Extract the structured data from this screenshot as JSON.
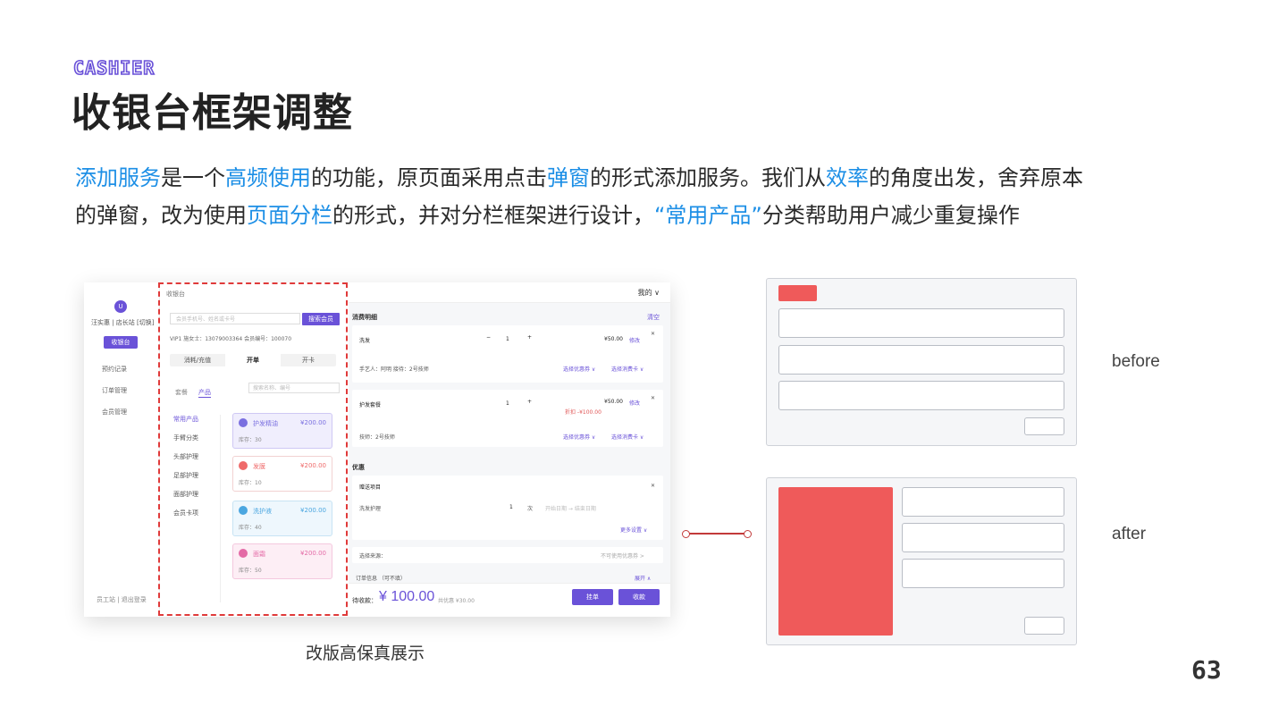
{
  "header": {
    "kicker": "CASHIER",
    "title": "收银台框架调整"
  },
  "description": {
    "line1": [
      {
        "text": "添加服务",
        "hl": true
      },
      {
        "text": "是一个",
        "hl": false
      },
      {
        "text": "高频使用",
        "hl": true
      },
      {
        "text": "的功能，原页面采用点击",
        "hl": false
      },
      {
        "text": "弹窗",
        "hl": true
      },
      {
        "text": "的形式添加服务。我们从",
        "hl": false
      },
      {
        "text": "效率",
        "hl": true
      },
      {
        "text": "的角度出发，舍弃原本",
        "hl": false
      }
    ],
    "line2": [
      {
        "text": "的弹窗，改为使用",
        "hl": false
      },
      {
        "text": "页面分栏",
        "hl": true
      },
      {
        "text": "的形式，并对分栏框架进行设计，",
        "hl": false
      },
      {
        "text": "“常用产品”",
        "hl": true
      },
      {
        "text": "分类帮助用户减少重复操作",
        "hl": false
      }
    ]
  },
  "colors": {
    "highlight": "#1d8fe6",
    "accent": "#6a52d8",
    "dash": "#e03a3a",
    "wire_red": "#ef5a5a"
  },
  "mockup": {
    "avatar": "U",
    "nav_user": "汪实惠 | 店长站 [切换]",
    "nav_button": "收银台",
    "nav_items": [
      "预约记录",
      "订单管理",
      "会员管理"
    ],
    "nav_foot": "员工站 | 退出登录",
    "mid_top": "收银台",
    "search_placeholder": "会员手机号、姓名或卡号",
    "search_button": "搜索会员",
    "member_info": "VIP1  施女士：13079003364  会员编号：100070",
    "mode_tabs": [
      "消耗/充值",
      "开单",
      "开卡"
    ],
    "sub_tabs": [
      "套餐",
      "产品"
    ],
    "product_search": "搜索名称、编号",
    "categories": [
      "常用产品",
      "手臂分类",
      "头部护理",
      "足部护理",
      "面部护理",
      "会员卡项"
    ],
    "products": [
      {
        "name": "护发精油",
        "price": "¥200.00",
        "stock": "库存：30",
        "color": "#7a6fe0",
        "bg": "#f0eefd",
        "border": "#cfc8f4"
      },
      {
        "name": "发膜",
        "price": "¥200.00",
        "stock": "库存：10",
        "color": "#ef6a6a",
        "bg": "#fff",
        "border": "#f2d2d2"
      },
      {
        "name": "洗护液",
        "price": "¥200.00",
        "stock": "库存：40",
        "color": "#4aa6e0",
        "bg": "#eef7fd",
        "border": "#c8e3f4"
      },
      {
        "name": "面霜",
        "price": "¥200.00",
        "stock": "库存：50",
        "color": "#e46aa6",
        "bg": "#fdeef5",
        "border": "#f4c8de"
      }
    ],
    "user_menu": "我的 ∨",
    "detail_title": "消费明细",
    "clear": "清空",
    "item1_name": "洗发",
    "item1_qty": "1",
    "item1_price": "¥50.00",
    "item1_link": "修改",
    "item1_staff": "手艺人：阿明  接待：2号技师",
    "item1_select1": "选择优惠券 ∨",
    "item1_select2": "选择消费卡 ∨",
    "item2_name": "护发套餐",
    "item2_qty": "1",
    "item2_price": "¥50.00",
    "item2_link": "修改",
    "item2_discount": "折扣 -¥100.00",
    "item2_staff": "技师：2号技师",
    "item2_select1": "选择优惠券 ∨",
    "item2_select2": "选择消费卡 ∨",
    "promo_title": "优惠",
    "promo_card_title": "赠送项目",
    "promo_item": "洗发护理",
    "promo_qty": "1",
    "promo_unit": "次",
    "promo_dates": "开始日期  →  结束日期",
    "promo_expand": "更多设置 ∨",
    "source_label": "选择来源：",
    "source_value": "不可使用优惠券 >",
    "order_info": "订单信息  （可不填）",
    "order_toggle": "展开 ∧",
    "pay_label": "待收款：",
    "pay_amount": "¥ 100.00",
    "pay_sub": "共优惠  ¥30.00",
    "btn_hold": "挂单",
    "btn_pay": "收款"
  },
  "caption": "改版高保真展示",
  "labels": {
    "before": "before",
    "after": "after"
  },
  "page_number": "63"
}
